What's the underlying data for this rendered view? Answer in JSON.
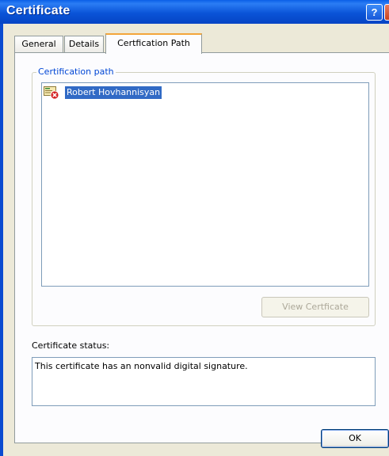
{
  "window": {
    "title": "Certificate",
    "help_label": "?",
    "close_label": "×"
  },
  "tabs": [
    {
      "label": "General"
    },
    {
      "label": "Details"
    },
    {
      "label": "Certfication Path"
    }
  ],
  "cert_path": {
    "group_label": "Certification path",
    "items": [
      {
        "label": "Robert Hovhannisyan",
        "selected": true
      }
    ],
    "view_button": "View Certficate"
  },
  "status": {
    "label": "Certificate status:",
    "text": "This certificate has an nonvalid digital signature."
  },
  "footer": {
    "ok_label": "OK"
  },
  "colors": {
    "title_bar": "#0A54D8",
    "selection": "#316AC5",
    "group_label": "#0046D5",
    "dialog_bg": "#ECE9D8"
  }
}
